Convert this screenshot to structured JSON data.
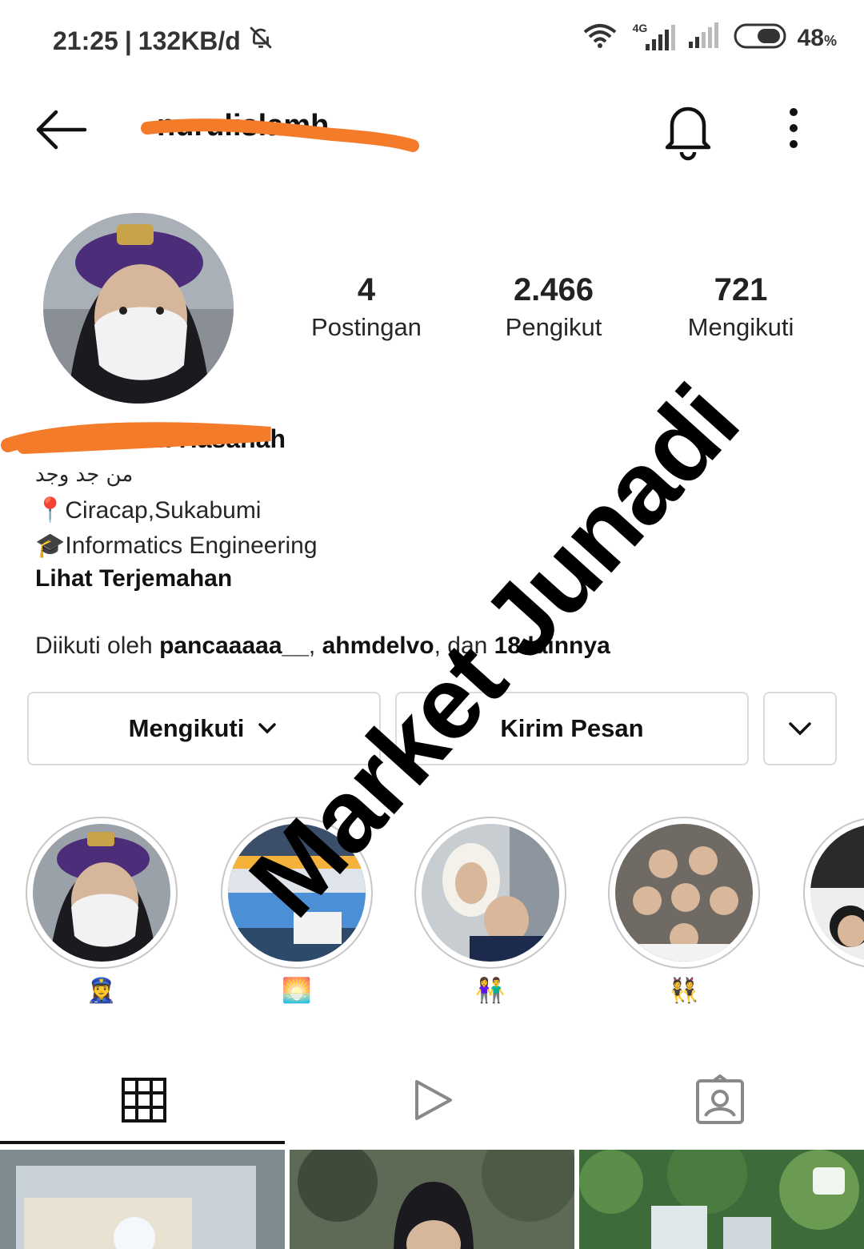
{
  "status_bar": {
    "time": "21:25",
    "separator": "|",
    "speed": "132KB/d",
    "network": "4G",
    "battery_value": "48",
    "battery_unit": "%"
  },
  "header": {
    "username": "nurulislamh"
  },
  "stats": [
    {
      "value": "4",
      "label": "Postingan"
    },
    {
      "value": "2.466",
      "label": "Pengikut"
    },
    {
      "value": "721",
      "label": "Mengikuti"
    }
  ],
  "bio": {
    "full_name": "nurul Islam Hasanah",
    "line_arabic": "من جد وجد",
    "line_location": "Ciracap,Sukabumi",
    "line_education": "Informatics Engineering",
    "see_translation": "Lihat Terjemahan"
  },
  "followed_by": {
    "prefix": "Diikuti oleh ",
    "user1": "pancaaaaa__",
    "sep": ", ",
    "user2": "ahmdelvo",
    "mid": ", dan ",
    "others": "18 lainnya"
  },
  "actions": {
    "following_label": "Mengikuti",
    "message_label": "Kirim Pesan"
  },
  "highlights": [
    {
      "label": "👮‍♀️"
    },
    {
      "label": "🌅"
    },
    {
      "label": "👫"
    },
    {
      "label": "👯"
    },
    {
      "label": ""
    }
  ],
  "watermark": "Market Junadi",
  "icons": {
    "back": "arrow-left-icon",
    "bell": "bell-icon",
    "more": "more-vertical-icon",
    "grid": "grid-icon",
    "reels": "play-icon",
    "tagged": "tagged-icon"
  }
}
